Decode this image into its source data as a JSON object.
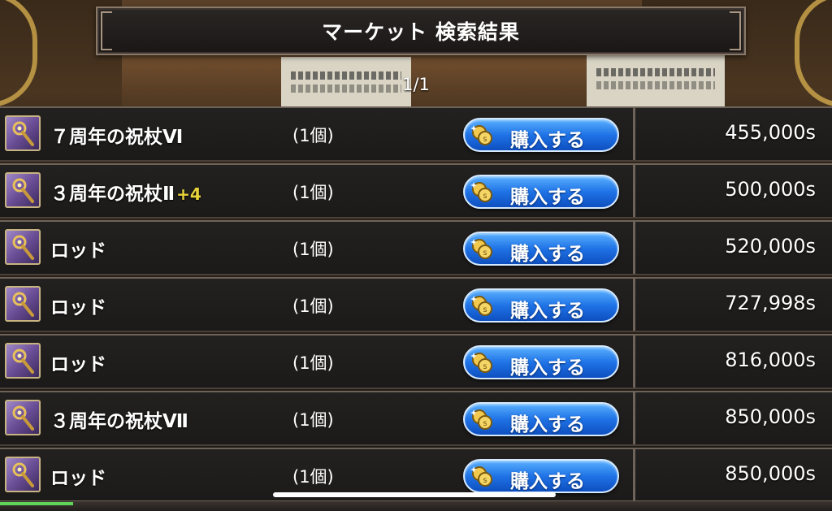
{
  "header": {
    "title": "マーケット 検索結果",
    "page": "1/1"
  },
  "labels": {
    "buy": "購入する"
  },
  "items": [
    {
      "name": "７周年の祝杖Ⅵ",
      "plus": "",
      "qty": "(1個)",
      "price": "455,000s"
    },
    {
      "name": "３周年の祝杖Ⅱ",
      "plus": "+4",
      "qty": "(1個)",
      "price": "500,000s"
    },
    {
      "name": "ロッド",
      "plus": "",
      "qty": "(1個)",
      "price": "520,000s"
    },
    {
      "name": "ロッド",
      "plus": "",
      "qty": "(1個)",
      "price": "727,998s"
    },
    {
      "name": "ロッド",
      "plus": "",
      "qty": "(1個)",
      "price": "816,000s"
    },
    {
      "name": "３周年の祝杖Ⅶ",
      "plus": "",
      "qty": "(1個)",
      "price": "850,000s"
    },
    {
      "name": "ロッド",
      "plus": "",
      "qty": "(1個)",
      "price": "850,000s"
    }
  ],
  "icons": {
    "item": "staff-icon",
    "currency": "coin-icon"
  },
  "colors": {
    "buy_button": "#1f73e6",
    "plus_value": "#e8d43a",
    "frame": "#6e6358"
  }
}
